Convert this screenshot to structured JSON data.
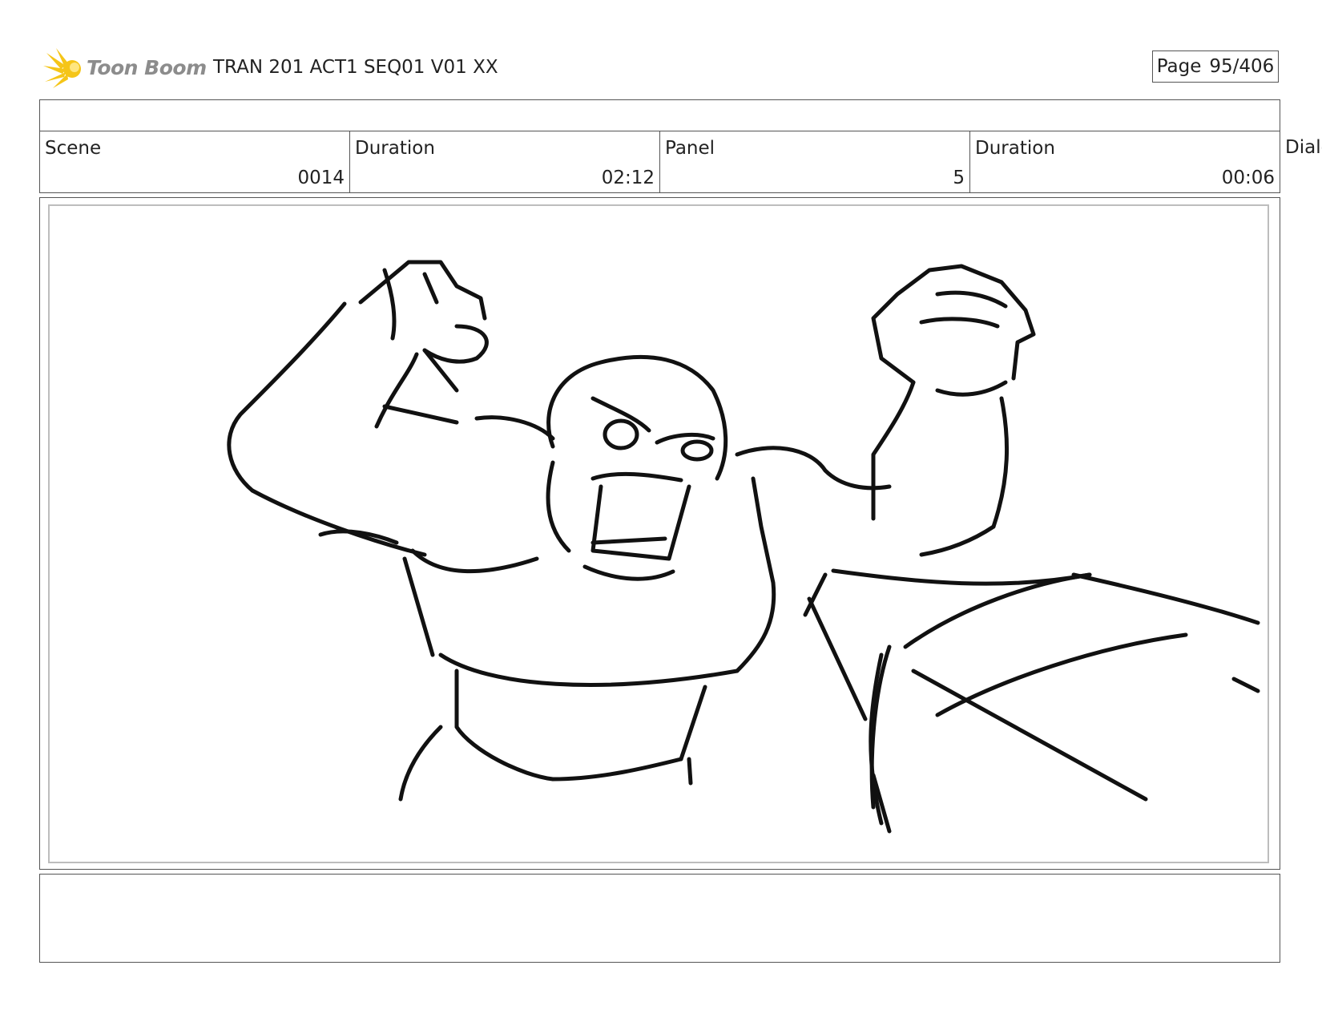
{
  "header": {
    "logo_text": "Toon Boom",
    "title": "TRAN 201 ACT1 SEQ01 V01 XX",
    "page_label": "Page",
    "page_value": "95/406"
  },
  "info": {
    "scene_label": "Scene",
    "scene_value": "0014",
    "scene_duration_label": "Duration",
    "scene_duration_value": "02:12",
    "panel_label": "Panel",
    "panel_value": "5",
    "panel_duration_label": "Duration",
    "panel_duration_value": "00:06",
    "dialog_label": "Dialo"
  },
  "colors": {
    "logo_accent": "#f5c518",
    "border": "#555555",
    "frame_inner": "#bdbdbd",
    "sketch_stroke": "#111111"
  },
  "icons": {
    "logo": "toon-boom-starburst-icon"
  }
}
